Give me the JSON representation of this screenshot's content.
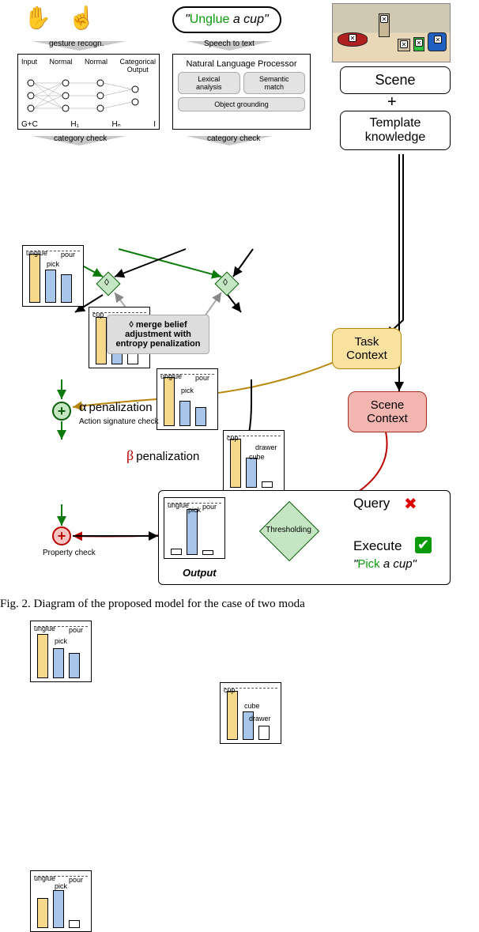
{
  "speech": {
    "quoted_verb": "Unglue",
    "quoted_rest": " a cup",
    "full": "\"Unglue a cup\""
  },
  "top": {
    "gesture_label": "gesture recogn.",
    "speech2text_label": "Speech to text",
    "nn": {
      "input": "Input",
      "normal1": "Normal",
      "normal2": "Normal",
      "out": "Categorical\nOutput",
      "gc": "G+C",
      "h1": "H₁",
      "hn": "Hₙ",
      "i": "I"
    },
    "nlp": {
      "title": "Natural Language Processor",
      "lex": "Lexical\nanalysis",
      "sem": "Semantic\nmatch",
      "grd": "Object grounding"
    },
    "cat_check": "category check"
  },
  "right": {
    "scene": "Scene",
    "plus": "+",
    "template": "Template\nknowledge"
  },
  "contexts": {
    "task": "Task\nContext",
    "scene": "Scene\nContext"
  },
  "barlabels": {
    "actions": {
      "unglue": "unglue",
      "pick": "pick",
      "pour": "pour"
    },
    "objects": {
      "cup": "cup",
      "cube": "cube",
      "drawer": "drawer"
    }
  },
  "merge_note": "◊ merge belief adjustment with entropy penalization",
  "alpha": {
    "sym": "α",
    "label": "penalization",
    "check": "Action signature check"
  },
  "beta": {
    "sym": "β",
    "label": "penalization",
    "check": "Property check"
  },
  "output": {
    "title": "Output",
    "thresholding": "Thresholding",
    "query": "Query",
    "execute": "Execute",
    "pick_verb": "Pick",
    "pick_rest": " a cup"
  },
  "caption": "Fig. 2.    Diagram  of  the  proposed  model  for  the  case  of  two  moda",
  "chart_data": [
    {
      "name": "gesture_actions",
      "type": "bar",
      "categories": [
        "unglue",
        "pick",
        "pour"
      ],
      "values": [
        0.9,
        0.6,
        0.5
      ],
      "ylim": [
        0,
        1
      ],
      "highlight": 0
    },
    {
      "name": "gesture_objects",
      "type": "bar",
      "categories": [
        "cup",
        "cube",
        "drawer"
      ],
      "values": [
        0.85,
        0.4,
        0.2
      ],
      "ylim": [
        0,
        1
      ],
      "highlight": 0
    },
    {
      "name": "nlp_actions",
      "type": "bar",
      "categories": [
        "unglue",
        "pick",
        "pour"
      ],
      "values": [
        0.9,
        0.45,
        0.35
      ],
      "ylim": [
        0,
        1
      ],
      "highlight": 0
    },
    {
      "name": "nlp_objects",
      "type": "bar",
      "categories": [
        "cup",
        "cube",
        "drawer"
      ],
      "values": [
        0.9,
        0.55,
        0.1
      ],
      "ylim": [
        0,
        1
      ],
      "highlight": 0
    },
    {
      "name": "merged_actions",
      "type": "bar",
      "categories": [
        "unglue",
        "pick",
        "pour"
      ],
      "values": [
        0.8,
        0.55,
        0.45
      ],
      "ylim": [
        0,
        1
      ],
      "highlight": 0
    },
    {
      "name": "merged_objects",
      "type": "bar",
      "categories": [
        "cup",
        "cube",
        "drawer"
      ],
      "values": [
        0.9,
        0.5,
        0.25
      ],
      "ylim": [
        0,
        1
      ],
      "highlight": 0
    },
    {
      "name": "alpha_actions",
      "type": "bar",
      "categories": [
        "unglue",
        "pick",
        "pour"
      ],
      "values": [
        0.55,
        0.7,
        0.15
      ],
      "ylim": [
        0,
        1
      ],
      "highlight": 1
    },
    {
      "name": "final_actions",
      "type": "bar",
      "categories": [
        "unglue",
        "pick",
        "pour"
      ],
      "values": [
        0.1,
        0.85,
        0.08
      ],
      "ylim": [
        0,
        1
      ],
      "highlight": 1
    }
  ]
}
